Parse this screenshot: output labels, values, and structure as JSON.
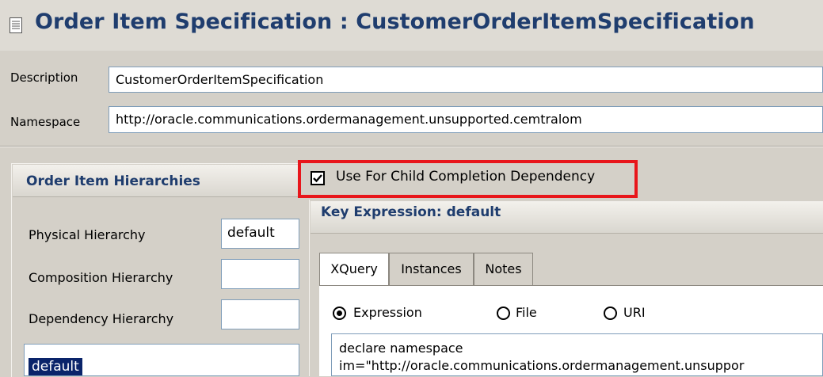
{
  "editor": {
    "title": "Order Item Specification : CustomerOrderItemSpecification",
    "icon": "document-icon"
  },
  "fields": {
    "description_label": "Description",
    "description_value": "CustomerOrderItemSpecification",
    "namespace_label": "Namespace",
    "namespace_value": "http://oracle.communications.ordermanagement.unsupported.cemtralom"
  },
  "hierarchies": {
    "title": "Order Item Hierarchies",
    "physical_label": "Physical Hierarchy",
    "physical_value": "default",
    "composition_label": "Composition Hierarchy",
    "composition_value": "",
    "dependency_label": "Dependency Hierarchy",
    "dependency_value": "",
    "list_items": [
      "default"
    ]
  },
  "dependency": {
    "checkbox_label": "Use For Child Completion Dependency",
    "checked": true,
    "highlight_color": "#e8161b"
  },
  "key_expression": {
    "title": "Key Expression: default",
    "tabs": [
      "XQuery",
      "Instances",
      "Notes"
    ],
    "active_tab": "XQuery",
    "radio_options": [
      "Expression",
      "File",
      "URI"
    ],
    "selected_radio": "Expression",
    "code_lines": [
      "declare namespace",
      "im=\"http://oracle.communications.ordermanagement.unsuppor"
    ]
  },
  "colors": {
    "title_text": "#1f3d6e",
    "panel_bg": "#d4d0c8",
    "selection": "#0a246a"
  }
}
